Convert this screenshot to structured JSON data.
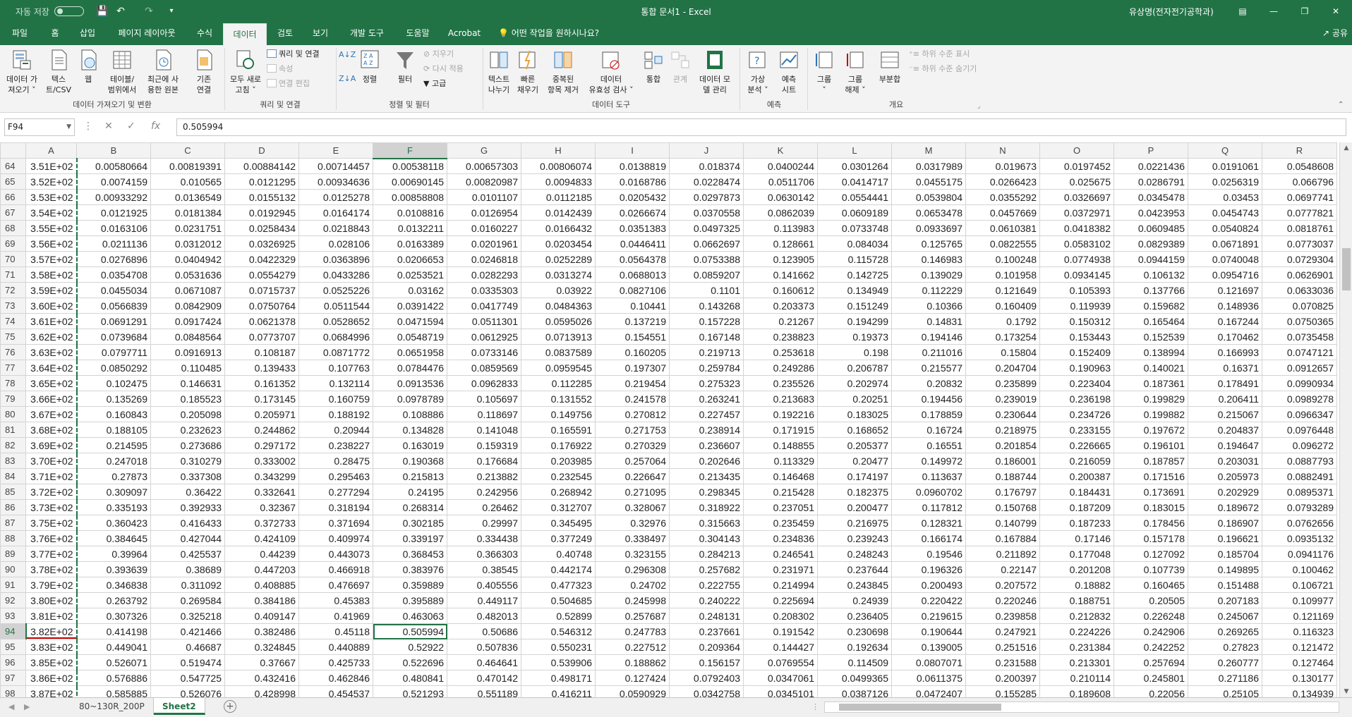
{
  "titlebar": {
    "autosave_label": "자동 저장",
    "autosave_state": "끔",
    "doc_title": "통합 문서1  -  Excel",
    "user": "유상명(전자전기공학과)",
    "save_icon": "save-icon",
    "undo_icon": "undo-icon",
    "redo_icon": "redo-icon"
  },
  "tabs": [
    {
      "label": "파일"
    },
    {
      "label": "홈"
    },
    {
      "label": "삽입"
    },
    {
      "label": "페이지 레이아웃"
    },
    {
      "label": "수식"
    },
    {
      "label": "데이터"
    },
    {
      "label": "검토"
    },
    {
      "label": "보기"
    },
    {
      "label": "개발 도구"
    },
    {
      "label": "도움말"
    },
    {
      "label": "Acrobat"
    }
  ],
  "tell_me": "어떤 작업을 원하시나요?",
  "share": "공유",
  "ribbon": {
    "get_data": "데이터 가\n져오기 ˅",
    "text_csv": "텍스\n트/CSV",
    "web": "웹",
    "from_table": "테이블/\n범위에서",
    "recent_sources": "최근에 사\n용한 원본",
    "existing_conn": "기존\n연결",
    "group1": "데이터 가져오기 및 변환",
    "refresh_all": "모두 새로\n고침 ˅",
    "queries_conn": "쿼리 및 연결",
    "properties": "속성",
    "edit_links": "연결 편집",
    "group2": "쿼리 및 연결",
    "sort": "정렬",
    "filter": "필터",
    "clear": "지우기",
    "reapply": "다시 적용",
    "advanced": "고급",
    "group3": "정렬 및 필터",
    "text_to_columns": "텍스트\n나누기",
    "flash_fill": "빠른\n채우기",
    "remove_dup": "중복된\n항목 제거",
    "data_validation": "데이터\n유효성 검사 ˅",
    "consolidate": "통합",
    "relationships": "관계",
    "data_model": "데이터 모\n델 관리",
    "group4": "데이터 도구",
    "what_if": "가상\n분석 ˅",
    "forecast_sheet": "예측\n시트",
    "group5": "예측",
    "group_btn": "그룹\n˅",
    "ungroup": "그룹\n해제 ˅",
    "subtotal": "부분합",
    "show_detail": "하위 수준 표시",
    "hide_detail": "하위 수준 숨기기",
    "group6": "개요"
  },
  "namebox": "F94",
  "formula": "0.505994",
  "columns": [
    "A",
    "B",
    "C",
    "D",
    "E",
    "F",
    "G",
    "H",
    "I",
    "J",
    "K",
    "L",
    "M",
    "N",
    "O",
    "P",
    "Q",
    "R"
  ],
  "rows": [
    {
      "n": "64",
      "c": [
        "3.51E+02",
        "0.00580664",
        "0.00819391",
        "0.00884142",
        "0.00714457",
        "0.00538118",
        "0.00657303",
        "0.00806074",
        "0.0138819",
        "0.018374",
        "0.0400244",
        "0.0301264",
        "0.0317989",
        "0.019673",
        "0.0197452",
        "0.0221436",
        "0.0191061",
        "0.0548608"
      ]
    },
    {
      "n": "65",
      "c": [
        "3.52E+02",
        "0.0074159",
        "0.010565",
        "0.0121295",
        "0.00934636",
        "0.00690145",
        "0.00820987",
        "0.0094833",
        "0.0168786",
        "0.0228474",
        "0.0511706",
        "0.0414717",
        "0.0455175",
        "0.0266423",
        "0.025675",
        "0.0286791",
        "0.0256319",
        "0.066796"
      ]
    },
    {
      "n": "66",
      "c": [
        "3.53E+02",
        "0.00933292",
        "0.0136549",
        "0.0155132",
        "0.0125278",
        "0.00858808",
        "0.0101107",
        "0.0112185",
        "0.0205432",
        "0.0297873",
        "0.0630142",
        "0.0554441",
        "0.0539804",
        "0.0355292",
        "0.0326697",
        "0.0345478",
        "0.03453",
        "0.0697741"
      ]
    },
    {
      "n": "67",
      "c": [
        "3.54E+02",
        "0.0121925",
        "0.0181384",
        "0.0192945",
        "0.0164174",
        "0.0108816",
        "0.0126954",
        "0.0142439",
        "0.0266674",
        "0.0370558",
        "0.0862039",
        "0.0609189",
        "0.0653478",
        "0.0457669",
        "0.0372971",
        "0.0423953",
        "0.0454743",
        "0.0777821"
      ]
    },
    {
      "n": "68",
      "c": [
        "3.55E+02",
        "0.0163106",
        "0.0231751",
        "0.0258434",
        "0.0218843",
        "0.0132211",
        "0.0160227",
        "0.0166432",
        "0.0351383",
        "0.0497325",
        "0.113983",
        "0.0733748",
        "0.0933697",
        "0.0610381",
        "0.0418382",
        "0.0609485",
        "0.0540824",
        "0.0818761"
      ]
    },
    {
      "n": "69",
      "c": [
        "3.56E+02",
        "0.0211136",
        "0.0312012",
        "0.0326925",
        "0.028106",
        "0.0163389",
        "0.0201961",
        "0.0203454",
        "0.0446411",
        "0.0662697",
        "0.128661",
        "0.084034",
        "0.125765",
        "0.0822555",
        "0.0583102",
        "0.0829389",
        "0.0671891",
        "0.0773037"
      ]
    },
    {
      "n": "70",
      "c": [
        "3.57E+02",
        "0.0276896",
        "0.0404942",
        "0.0422329",
        "0.0363896",
        "0.0206653",
        "0.0246818",
        "0.0252289",
        "0.0564378",
        "0.0753388",
        "0.123905",
        "0.115728",
        "0.146983",
        "0.100248",
        "0.0774938",
        "0.0944159",
        "0.0740048",
        "0.0729304"
      ]
    },
    {
      "n": "71",
      "c": [
        "3.58E+02",
        "0.0354708",
        "0.0531636",
        "0.0554279",
        "0.0433286",
        "0.0253521",
        "0.0282293",
        "0.0313274",
        "0.0688013",
        "0.0859207",
        "0.141662",
        "0.142725",
        "0.139029",
        "0.101958",
        "0.0934145",
        "0.106132",
        "0.0954716",
        "0.0626901"
      ]
    },
    {
      "n": "72",
      "c": [
        "3.59E+02",
        "0.0455034",
        "0.0671087",
        "0.0715737",
        "0.0525226",
        "0.03162",
        "0.0335303",
        "0.03922",
        "0.0827106",
        "0.1101",
        "0.160612",
        "0.134949",
        "0.112229",
        "0.121649",
        "0.105393",
        "0.137766",
        "0.121697",
        "0.0633036"
      ]
    },
    {
      "n": "73",
      "c": [
        "3.60E+02",
        "0.0566839",
        "0.0842909",
        "0.0750764",
        "0.0511544",
        "0.0391422",
        "0.0417749",
        "0.0484363",
        "0.10441",
        "0.143268",
        "0.203373",
        "0.151249",
        "0.10366",
        "0.160409",
        "0.119939",
        "0.159682",
        "0.148936",
        "0.070825"
      ]
    },
    {
      "n": "74",
      "c": [
        "3.61E+02",
        "0.0691291",
        "0.0917424",
        "0.0621378",
        "0.0528652",
        "0.0471594",
        "0.0511301",
        "0.0595026",
        "0.137219",
        "0.157228",
        "0.21267",
        "0.194299",
        "0.14831",
        "0.1792",
        "0.150312",
        "0.165464",
        "0.167244",
        "0.0750365"
      ]
    },
    {
      "n": "75",
      "c": [
        "3.62E+02",
        "0.0739684",
        "0.0848564",
        "0.0773707",
        "0.0684996",
        "0.0548719",
        "0.0612925",
        "0.0713913",
        "0.154551",
        "0.167148",
        "0.238823",
        "0.19373",
        "0.194146",
        "0.173254",
        "0.153443",
        "0.152539",
        "0.170462",
        "0.0735458"
      ]
    },
    {
      "n": "76",
      "c": [
        "3.63E+02",
        "0.0797711",
        "0.0916913",
        "0.108187",
        "0.0871772",
        "0.0651958",
        "0.0733146",
        "0.0837589",
        "0.160205",
        "0.219713",
        "0.253618",
        "0.198",
        "0.211016",
        "0.15804",
        "0.152409",
        "0.138994",
        "0.166993",
        "0.0747121"
      ]
    },
    {
      "n": "77",
      "c": [
        "3.64E+02",
        "0.0850292",
        "0.110485",
        "0.139433",
        "0.107763",
        "0.0784476",
        "0.0859569",
        "0.0959545",
        "0.197307",
        "0.259784",
        "0.249286",
        "0.206787",
        "0.215577",
        "0.204704",
        "0.190963",
        "0.140021",
        "0.16371",
        "0.0912657"
      ]
    },
    {
      "n": "78",
      "c": [
        "3.65E+02",
        "0.102475",
        "0.146631",
        "0.161352",
        "0.132114",
        "0.0913536",
        "0.0962833",
        "0.112285",
        "0.219454",
        "0.275323",
        "0.235526",
        "0.202974",
        "0.20832",
        "0.235899",
        "0.223404",
        "0.187361",
        "0.178491",
        "0.0990934"
      ]
    },
    {
      "n": "79",
      "c": [
        "3.66E+02",
        "0.135269",
        "0.185523",
        "0.173145",
        "0.160759",
        "0.0978789",
        "0.105697",
        "0.131552",
        "0.241578",
        "0.263241",
        "0.213683",
        "0.20251",
        "0.194456",
        "0.239019",
        "0.236198",
        "0.199829",
        "0.206411",
        "0.0989278"
      ]
    },
    {
      "n": "80",
      "c": [
        "3.67E+02",
        "0.160843",
        "0.205098",
        "0.205971",
        "0.188192",
        "0.108886",
        "0.118697",
        "0.149756",
        "0.270812",
        "0.227457",
        "0.192216",
        "0.183025",
        "0.178859",
        "0.230644",
        "0.234726",
        "0.199882",
        "0.215067",
        "0.0966347"
      ]
    },
    {
      "n": "81",
      "c": [
        "3.68E+02",
        "0.188105",
        "0.232623",
        "0.244862",
        "0.20944",
        "0.134828",
        "0.141048",
        "0.165591",
        "0.271753",
        "0.238914",
        "0.171915",
        "0.168652",
        "0.16724",
        "0.218975",
        "0.233155",
        "0.197672",
        "0.204837",
        "0.0976448"
      ]
    },
    {
      "n": "82",
      "c": [
        "3.69E+02",
        "0.214595",
        "0.273686",
        "0.297172",
        "0.238227",
        "0.163019",
        "0.159319",
        "0.176922",
        "0.270329",
        "0.236607",
        "0.148855",
        "0.205377",
        "0.16551",
        "0.201854",
        "0.226665",
        "0.196101",
        "0.194647",
        "0.096272"
      ]
    },
    {
      "n": "83",
      "c": [
        "3.70E+02",
        "0.247018",
        "0.310279",
        "0.333002",
        "0.28475",
        "0.190368",
        "0.176684",
        "0.203985",
        "0.257064",
        "0.202646",
        "0.113329",
        "0.20477",
        "0.149972",
        "0.186001",
        "0.216059",
        "0.187857",
        "0.203031",
        "0.0887793"
      ]
    },
    {
      "n": "84",
      "c": [
        "3.71E+02",
        "0.27873",
        "0.337308",
        "0.343299",
        "0.295463",
        "0.215813",
        "0.213882",
        "0.232545",
        "0.226647",
        "0.213435",
        "0.146468",
        "0.174197",
        "0.113637",
        "0.188744",
        "0.200387",
        "0.171516",
        "0.205973",
        "0.0882491"
      ]
    },
    {
      "n": "85",
      "c": [
        "3.72E+02",
        "0.309097",
        "0.36422",
        "0.332641",
        "0.277294",
        "0.24195",
        "0.242956",
        "0.268942",
        "0.271095",
        "0.298345",
        "0.215428",
        "0.182375",
        "0.0960702",
        "0.176797",
        "0.184431",
        "0.173691",
        "0.202929",
        "0.0895371"
      ]
    },
    {
      "n": "86",
      "c": [
        "3.73E+02",
        "0.335193",
        "0.392933",
        "0.32367",
        "0.318194",
        "0.268314",
        "0.26462",
        "0.312707",
        "0.328067",
        "0.318922",
        "0.237051",
        "0.200477",
        "0.117812",
        "0.150768",
        "0.187209",
        "0.183015",
        "0.189672",
        "0.0793289"
      ]
    },
    {
      "n": "87",
      "c": [
        "3.75E+02",
        "0.360423",
        "0.416433",
        "0.372733",
        "0.371694",
        "0.302185",
        "0.29997",
        "0.345495",
        "0.32976",
        "0.315663",
        "0.235459",
        "0.216975",
        "0.128321",
        "0.140799",
        "0.187233",
        "0.178456",
        "0.186907",
        "0.0762656"
      ]
    },
    {
      "n": "88",
      "c": [
        "3.76E+02",
        "0.384645",
        "0.427044",
        "0.424109",
        "0.409974",
        "0.339197",
        "0.334438",
        "0.377249",
        "0.338497",
        "0.304143",
        "0.234836",
        "0.239243",
        "0.166174",
        "0.167884",
        "0.17146",
        "0.157178",
        "0.196621",
        "0.0935132"
      ]
    },
    {
      "n": "89",
      "c": [
        "3.77E+02",
        "0.39964",
        "0.425537",
        "0.44239",
        "0.443073",
        "0.368453",
        "0.366303",
        "0.40748",
        "0.323155",
        "0.284213",
        "0.246541",
        "0.248243",
        "0.19546",
        "0.211892",
        "0.177048",
        "0.127092",
        "0.185704",
        "0.0941176"
      ]
    },
    {
      "n": "90",
      "c": [
        "3.78E+02",
        "0.393639",
        "0.38689",
        "0.447203",
        "0.466918",
        "0.383976",
        "0.38545",
        "0.442174",
        "0.296308",
        "0.257682",
        "0.231971",
        "0.237644",
        "0.196326",
        "0.22147",
        "0.201208",
        "0.107739",
        "0.149895",
        "0.100462"
      ]
    },
    {
      "n": "91",
      "c": [
        "3.79E+02",
        "0.346838",
        "0.311092",
        "0.408885",
        "0.476697",
        "0.359889",
        "0.405556",
        "0.477323",
        "0.24702",
        "0.222755",
        "0.214994",
        "0.243845",
        "0.200493",
        "0.207572",
        "0.18882",
        "0.160465",
        "0.151488",
        "0.106721"
      ]
    },
    {
      "n": "92",
      "c": [
        "3.80E+02",
        "0.263792",
        "0.269584",
        "0.384186",
        "0.45383",
        "0.395889",
        "0.449117",
        "0.504685",
        "0.245998",
        "0.240222",
        "0.225694",
        "0.24939",
        "0.220422",
        "0.220246",
        "0.188751",
        "0.20505",
        "0.207183",
        "0.109977"
      ]
    },
    {
      "n": "93",
      "c": [
        "3.81E+02",
        "0.307326",
        "0.325218",
        "0.409147",
        "0.41969",
        "0.463063",
        "0.482013",
        "0.52899",
        "0.257687",
        "0.248131",
        "0.208302",
        "0.236405",
        "0.219615",
        "0.239858",
        "0.212832",
        "0.226248",
        "0.245067",
        "0.121169"
      ]
    },
    {
      "n": "94",
      "c": [
        "3.82E+02",
        "0.414198",
        "0.421466",
        "0.382486",
        "0.45118",
        "0.505994",
        "0.50686",
        "0.546312",
        "0.247783",
        "0.237661",
        "0.191542",
        "0.230698",
        "0.190644",
        "0.247921",
        "0.224226",
        "0.242906",
        "0.269265",
        "0.116323"
      ]
    },
    {
      "n": "95",
      "c": [
        "3.83E+02",
        "0.449041",
        "0.46687",
        "0.324845",
        "0.440889",
        "0.52922",
        "0.507836",
        "0.550231",
        "0.227512",
        "0.209364",
        "0.144427",
        "0.192634",
        "0.139005",
        "0.251516",
        "0.231384",
        "0.242252",
        "0.27823",
        "0.121472"
      ]
    },
    {
      "n": "96",
      "c": [
        "3.85E+02",
        "0.526071",
        "0.519474",
        "0.37667",
        "0.425733",
        "0.522696",
        "0.464641",
        "0.539906",
        "0.188862",
        "0.156157",
        "0.0769554",
        "0.114509",
        "0.0807071",
        "0.231588",
        "0.213301",
        "0.257694",
        "0.260777",
        "0.127464"
      ]
    },
    {
      "n": "97",
      "c": [
        "3.86E+02",
        "0.576886",
        "0.547725",
        "0.432416",
        "0.462846",
        "0.480841",
        "0.470142",
        "0.498171",
        "0.127424",
        "0.0792403",
        "0.0347061",
        "0.0499365",
        "0.0611375",
        "0.200397",
        "0.210114",
        "0.245801",
        "0.271186",
        "0.130177"
      ]
    },
    {
      "n": "98",
      "c": [
        "3.87E+02",
        "0.585885",
        "0.526076",
        "0.428998",
        "0.454537",
        "0.521293",
        "0.551189",
        "0.416211",
        "0.0590929",
        "0.0342758",
        "0.0345101",
        "0.0387126",
        "0.0472407",
        "0.155285",
        "0.189608",
        "0.22056",
        "0.25105",
        "0.134939"
      ]
    }
  ],
  "active_cell": {
    "row": "94",
    "col": "F"
  },
  "sheets": [
    {
      "label": "80~130R_200P",
      "active": false
    },
    {
      "label": "Sheet2",
      "active": true
    }
  ],
  "colors": {
    "accent": "#217346",
    "annotation": "#d00000"
  }
}
